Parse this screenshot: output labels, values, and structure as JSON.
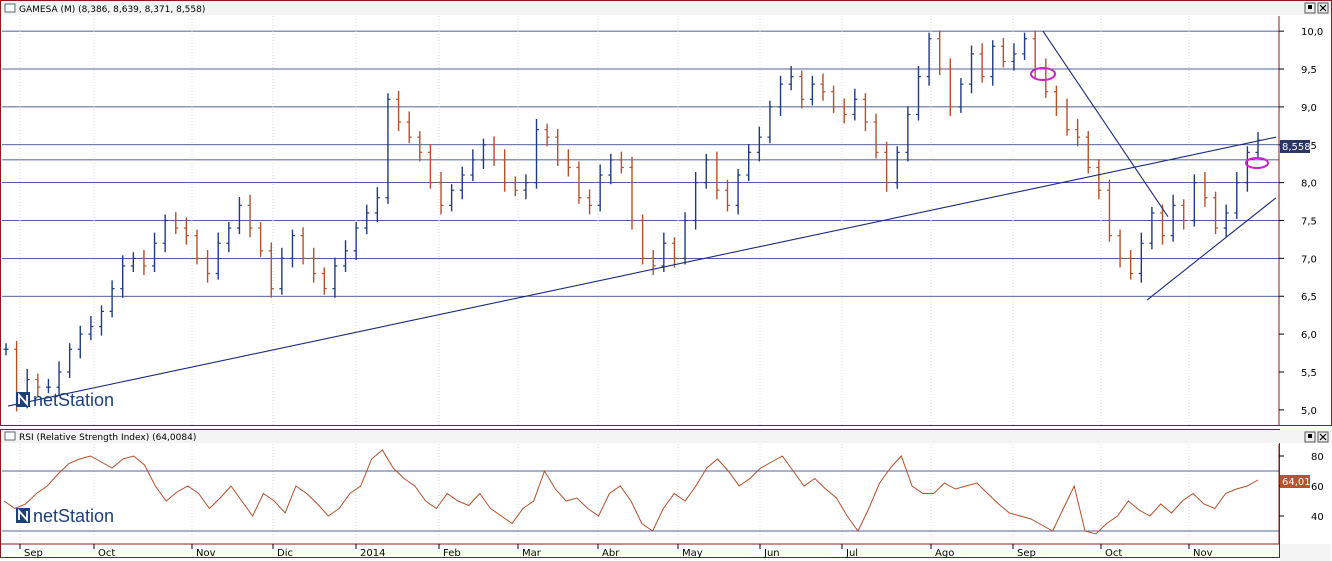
{
  "window": {
    "main_title": "GAMESA (M) (8,386, 8,639, 8,371, 8,558)",
    "rsi_title": "RSI (Relative Strength Index) (64,0084)",
    "brand": "netStation",
    "colors": {
      "background": "#ffffff",
      "frame": "#8b1a1a",
      "up_bar": "#1f3a80",
      "down_bar": "#b5502a",
      "trendline": "#1a2a7a",
      "rsi_line": "#b5502a",
      "marker": "#cc22cc",
      "badge_price": "#2b3566",
      "badge_rsi": "#c0502a"
    }
  },
  "chart_data": [
    {
      "type": "ohlc",
      "title": "GAMESA (M) (8,386, 8,639, 8,371, 8,558)",
      "last_open": 8.386,
      "last_high": 8.639,
      "last_low": 8.371,
      "last_close": 8.558,
      "price_badge": "8,558",
      "ylim": [
        4.8,
        10.2
      ],
      "yticks": [
        "10,0",
        "9,5",
        "9,0",
        "8,5",
        "8,0",
        "7,5",
        "7,0",
        "6,5",
        "6,0",
        "5,5",
        "5,0"
      ],
      "horizontal_levels": [
        10.0,
        9.5,
        9.0,
        8.5,
        8.3,
        8.0,
        7.5,
        7.0,
        6.5
      ],
      "x_labels": [
        "Sep",
        "Oct",
        "Nov",
        "Dic",
        "2014",
        "Feb",
        "Mar",
        "Abr",
        "May",
        "Jun",
        "Jul",
        "Ago",
        "Sep",
        "Oct",
        "Nov"
      ],
      "close_series": [
        5.8,
        5.1,
        5.4,
        5.3,
        5.3,
        5.5,
        5.8,
        6.0,
        6.1,
        6.3,
        6.6,
        6.9,
        7.0,
        6.9,
        7.2,
        7.5,
        7.4,
        7.3,
        7.0,
        6.8,
        7.2,
        7.4,
        7.7,
        7.4,
        7.1,
        6.6,
        7.0,
        7.3,
        7.0,
        6.8,
        6.6,
        6.9,
        7.1,
        7.4,
        7.6,
        7.8,
        9.1,
        8.8,
        8.6,
        8.4,
        8.0,
        7.7,
        7.9,
        8.1,
        8.3,
        8.5,
        8.3,
        8.0,
        7.9,
        8.0,
        8.7,
        8.6,
        8.3,
        8.2,
        7.8,
        7.7,
        8.1,
        8.3,
        8.2,
        7.5,
        7.0,
        6.9,
        7.2,
        7.0,
        7.5,
        8.0,
        8.3,
        7.9,
        7.7,
        8.1,
        8.4,
        8.6,
        9.0,
        9.3,
        9.4,
        9.1,
        9.3,
        9.2,
        9.0,
        8.9,
        9.1,
        8.8,
        8.4,
        8.0,
        8.4,
        8.9,
        9.4,
        9.9,
        9.5,
        9.0,
        9.3,
        9.7,
        9.4,
        9.8,
        9.6,
        9.7,
        9.9,
        9.5,
        9.2,
        9.0,
        8.7,
        8.6,
        8.2,
        7.9,
        7.3,
        7.0,
        6.8,
        7.2,
        7.6,
        7.3,
        7.7,
        7.5,
        8.0,
        7.8,
        7.4,
        7.6,
        8.0,
        8.4,
        8.56
      ],
      "trendlines": [
        {
          "from": [
            "Sep",
            5.05
          ],
          "to": [
            "Nov",
            8.6
          ]
        },
        {
          "from": [
            "Sep",
            10.0
          ],
          "to": [
            "Oct",
            7.55
          ]
        },
        {
          "from": [
            "Oct",
            6.45
          ],
          "to": [
            "Nov",
            7.8
          ]
        }
      ]
    },
    {
      "type": "line",
      "title": "RSI (Relative Strength Index) (64,0084)",
      "last_value": 64.0084,
      "value_badge": "64,01",
      "ylim": [
        22,
        88
      ],
      "yticks": [
        "80",
        "60",
        "40"
      ],
      "levels": [
        70,
        30
      ],
      "values": [
        50,
        45,
        48,
        55,
        60,
        68,
        75,
        78,
        80,
        76,
        72,
        78,
        80,
        74,
        60,
        50,
        56,
        60,
        55,
        45,
        52,
        60,
        50,
        40,
        55,
        50,
        42,
        60,
        55,
        48,
        40,
        45,
        55,
        60,
        78,
        84,
        72,
        65,
        60,
        50,
        45,
        55,
        50,
        47,
        55,
        45,
        40,
        35,
        45,
        50,
        70,
        58,
        50,
        52,
        45,
        40,
        55,
        60,
        50,
        35,
        30,
        45,
        55,
        50,
        60,
        72,
        78,
        70,
        60,
        65,
        72,
        76,
        80,
        70,
        60,
        65,
        58,
        52,
        40,
        30,
        45,
        62,
        72,
        80,
        60,
        55,
        55,
        62,
        58,
        60,
        62,
        55,
        48,
        42,
        40,
        38,
        34,
        30,
        45,
        60,
        30,
        28,
        35,
        40,
        50,
        44,
        40,
        48,
        42,
        50,
        55,
        48,
        45,
        55,
        58,
        60,
        64
      ]
    }
  ]
}
